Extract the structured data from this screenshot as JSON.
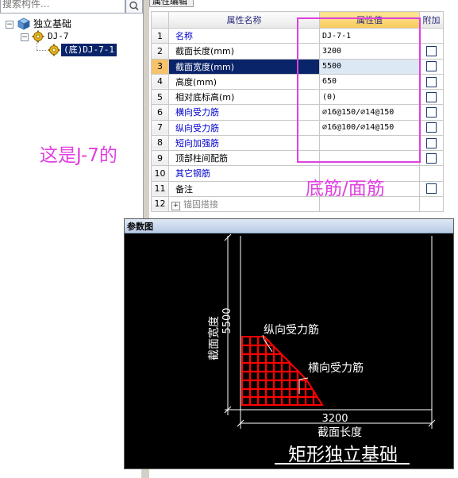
{
  "search": {
    "placeholder": "搜索构件..."
  },
  "tree": {
    "root_label": "独立基础",
    "child_label": "DJ-7",
    "leaf_label": "(底)DJ-7-1",
    "root_toggle": "−",
    "child_toggle": "−"
  },
  "annotations": {
    "left_note": "这是J-7的",
    "right_note": "底筋/面筋"
  },
  "prop_tab": {
    "label": "属性编辑"
  },
  "grid": {
    "header_name": "属性名称",
    "header_value": "属性值",
    "header_attach": "附加",
    "rows": [
      {
        "num": "1",
        "name": "名称",
        "value": "DJ-7-1",
        "checkbox": false
      },
      {
        "num": "2",
        "name": "截面长度(mm)",
        "value": "3200",
        "checkbox": true
      },
      {
        "num": "3",
        "name": "截面宽度(mm)",
        "value": "5500",
        "checkbox": true
      },
      {
        "num": "4",
        "name": "高度(mm)",
        "value": "650",
        "checkbox": true
      },
      {
        "num": "5",
        "name": "相对底标高(m)",
        "value": "(0)",
        "checkbox": true
      },
      {
        "num": "6",
        "name": "横向受力筋",
        "value": "⌀16@150/⌀14@150",
        "checkbox": true
      },
      {
        "num": "7",
        "name": "纵向受力筋",
        "value": "⌀16@100/⌀14@150",
        "checkbox": true
      },
      {
        "num": "8",
        "name": "短向加强筋",
        "value": "",
        "checkbox": true
      },
      {
        "num": "9",
        "name": "顶部柱间配筋",
        "value": "",
        "checkbox": true
      },
      {
        "num": "10",
        "name": "其它钢筋",
        "value": "",
        "checkbox": false
      },
      {
        "num": "11",
        "name": "备注",
        "value": "",
        "checkbox": true
      },
      {
        "num": "12",
        "name": "锚固搭接",
        "value": "",
        "checkbox": false
      }
    ]
  },
  "param_window": {
    "title": "参数图",
    "drawing": {
      "width_label": "截面宽度",
      "width_value": "5500",
      "length_label": "截面长度",
      "length_value": "3200",
      "longitudinal_label": "纵向受力筋",
      "transverse_label": "横向受力筋",
      "caption": "矩形独立基础"
    }
  },
  "colors": {
    "annotation": "#e040e0",
    "selection": "#0a246a",
    "header_value_bg": "#f7c95a",
    "rebar": "#ff0000",
    "canvas_bg": "#000000",
    "blue_text": "#0000cc"
  }
}
